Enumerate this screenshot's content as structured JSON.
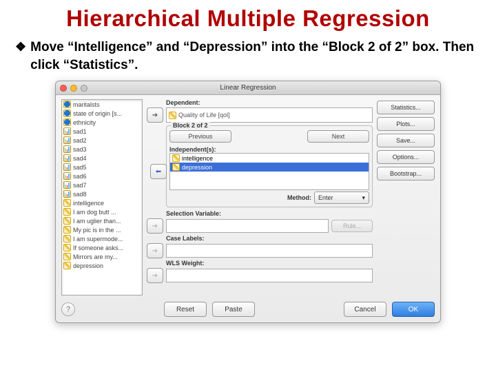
{
  "slide": {
    "title": "Hierarchical Multiple Regression",
    "bullet": "Move “Intelligence” and “Depression” into the “Block 2 of 2” box. Then click “Statistics”."
  },
  "dialog": {
    "title": "Linear Regression",
    "variables": [
      {
        "icon": "nom",
        "label": "maritalsts"
      },
      {
        "icon": "nom",
        "label": "state of origin [s..."
      },
      {
        "icon": "nom",
        "label": "ethnicity"
      },
      {
        "icon": "ord",
        "label": "sad1"
      },
      {
        "icon": "ord",
        "label": "sad2"
      },
      {
        "icon": "ord",
        "label": "sad3"
      },
      {
        "icon": "ord",
        "label": "sad4"
      },
      {
        "icon": "ord",
        "label": "sad5"
      },
      {
        "icon": "ord",
        "label": "sad6"
      },
      {
        "icon": "ord",
        "label": "sad7"
      },
      {
        "icon": "ord",
        "label": "sad8"
      },
      {
        "icon": "scl",
        "label": "intelligence"
      },
      {
        "icon": "scl",
        "label": "I am dog butt ..."
      },
      {
        "icon": "scl",
        "label": "I am uglier than..."
      },
      {
        "icon": "scl",
        "label": "My pic is in the ..."
      },
      {
        "icon": "scl",
        "label": "I am supermode..."
      },
      {
        "icon": "scl",
        "label": "If someone asks..."
      },
      {
        "icon": "scl",
        "label": "Mirrors are my..."
      },
      {
        "icon": "scl",
        "label": "depression"
      }
    ],
    "dependent_label": "Dependent:",
    "dependent_value": "Quality of Life  [qol]",
    "block_label": "Block 2 of 2",
    "previous": "Previous",
    "next": "Next",
    "independent_label": "Independent(s):",
    "independents": [
      {
        "label": "intelligence",
        "sel": false
      },
      {
        "label": "depression",
        "sel": true
      }
    ],
    "method_label": "Method:",
    "method_value": "Enter",
    "selection_label": "Selection Variable:",
    "rule": "Rule...",
    "case_labels": "Case Labels:",
    "wls_label": "WLS Weight:",
    "right_buttons": [
      "Statistics...",
      "Plots...",
      "Save...",
      "Options...",
      "Bootstrap..."
    ],
    "footer": {
      "help": "?",
      "reset": "Reset",
      "paste": "Paste",
      "cancel": "Cancel",
      "ok": "OK"
    }
  }
}
